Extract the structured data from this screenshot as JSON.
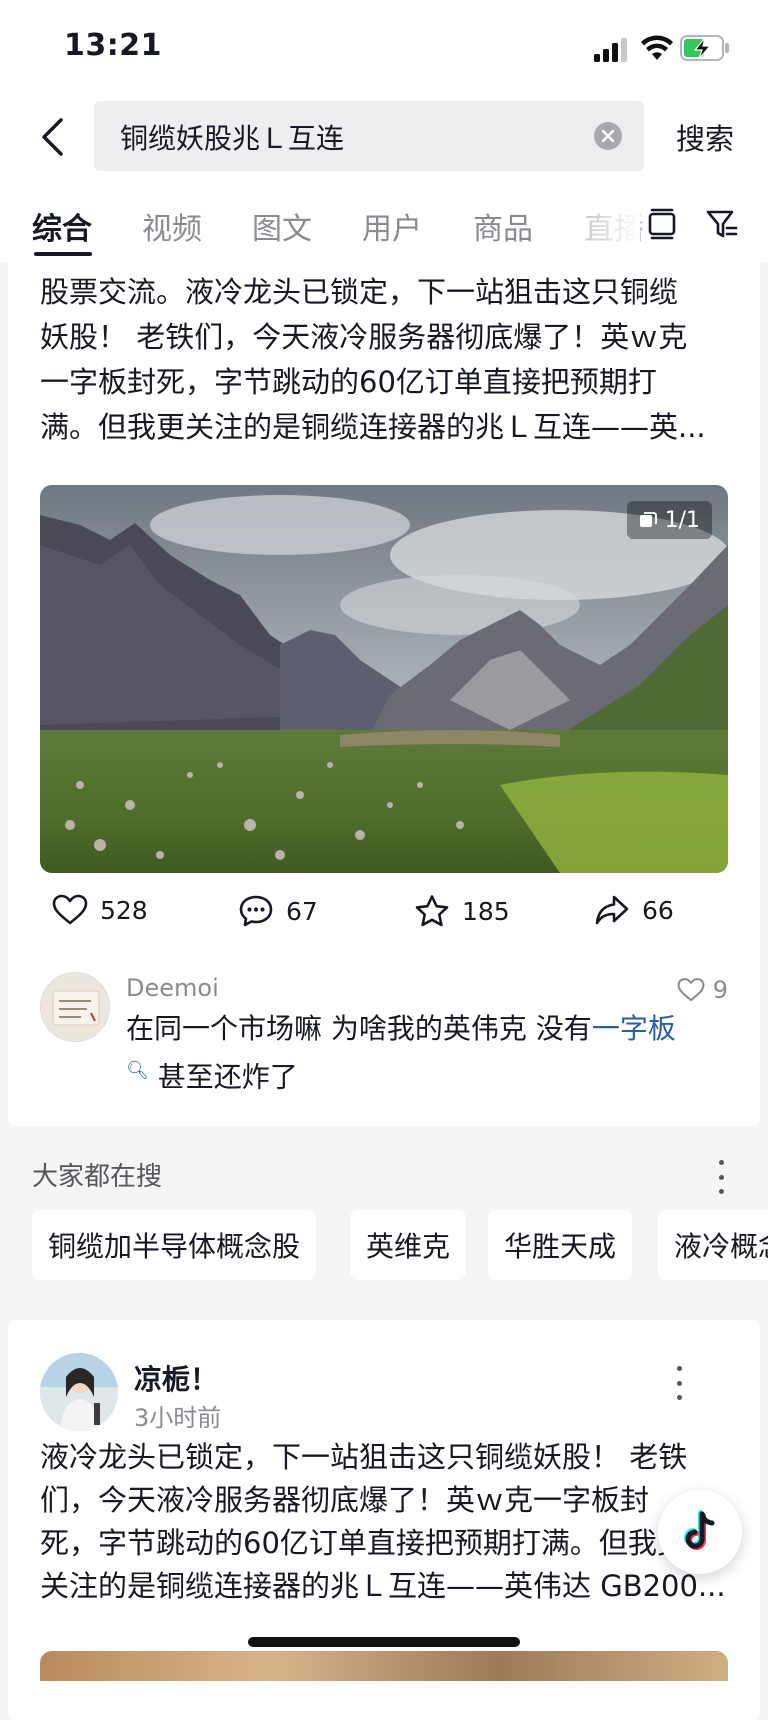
{
  "status_bar": {
    "time": "13:21"
  },
  "search": {
    "query": "铜缆妖股兆Ｌ互连",
    "submit_label": "搜索"
  },
  "tabs": [
    {
      "label": "综合",
      "active": true
    },
    {
      "label": "视频"
    },
    {
      "label": "图文"
    },
    {
      "label": "用户"
    },
    {
      "label": "商品"
    },
    {
      "label": "直播"
    }
  ],
  "post1": {
    "text_lines": [
      "股票交流。液冷龙头已锁定，下一站狙击这只铜缆",
      "妖股！ 老铁们，今天液冷服务器彻底爆了！英ｗ克",
      "一字板封死，字节跳动的60亿订单直接把预期打",
      "满。但我更关注的是铜缆连接器的兆Ｌ互连——英..."
    ],
    "image_badge": "1/1",
    "likes": "528",
    "comments": "67",
    "favorites": "185",
    "shares": "66",
    "top_comment": {
      "user": "Deemoi",
      "likes": "9",
      "text_before": "在同一个市场嘛 为啥我的英伟克 没有",
      "link_text": "一字板",
      "text_after": " 甚至还炸了"
    }
  },
  "everyone_search": {
    "title": "大家都在搜",
    "items": [
      "铜缆加半导体概念股",
      "英维克",
      "华胜天成",
      "液冷概念"
    ]
  },
  "post2": {
    "author": "凉栀！",
    "time": "3小时前",
    "text_lines": [
      "液冷龙头已锁定，下一站狙击这只铜缆妖股！ 老铁",
      "们，今天液冷服务器彻底爆了！英ｗ克一字板封",
      "死，字节跳动的60亿订单直接把预期打满。但我更",
      "关注的是铜缆连接器的兆Ｌ互连——英伟达 GB200..."
    ]
  },
  "colors": {
    "link": "#2a5f9e",
    "text": "#161823",
    "secondary": "#8a8b91"
  }
}
